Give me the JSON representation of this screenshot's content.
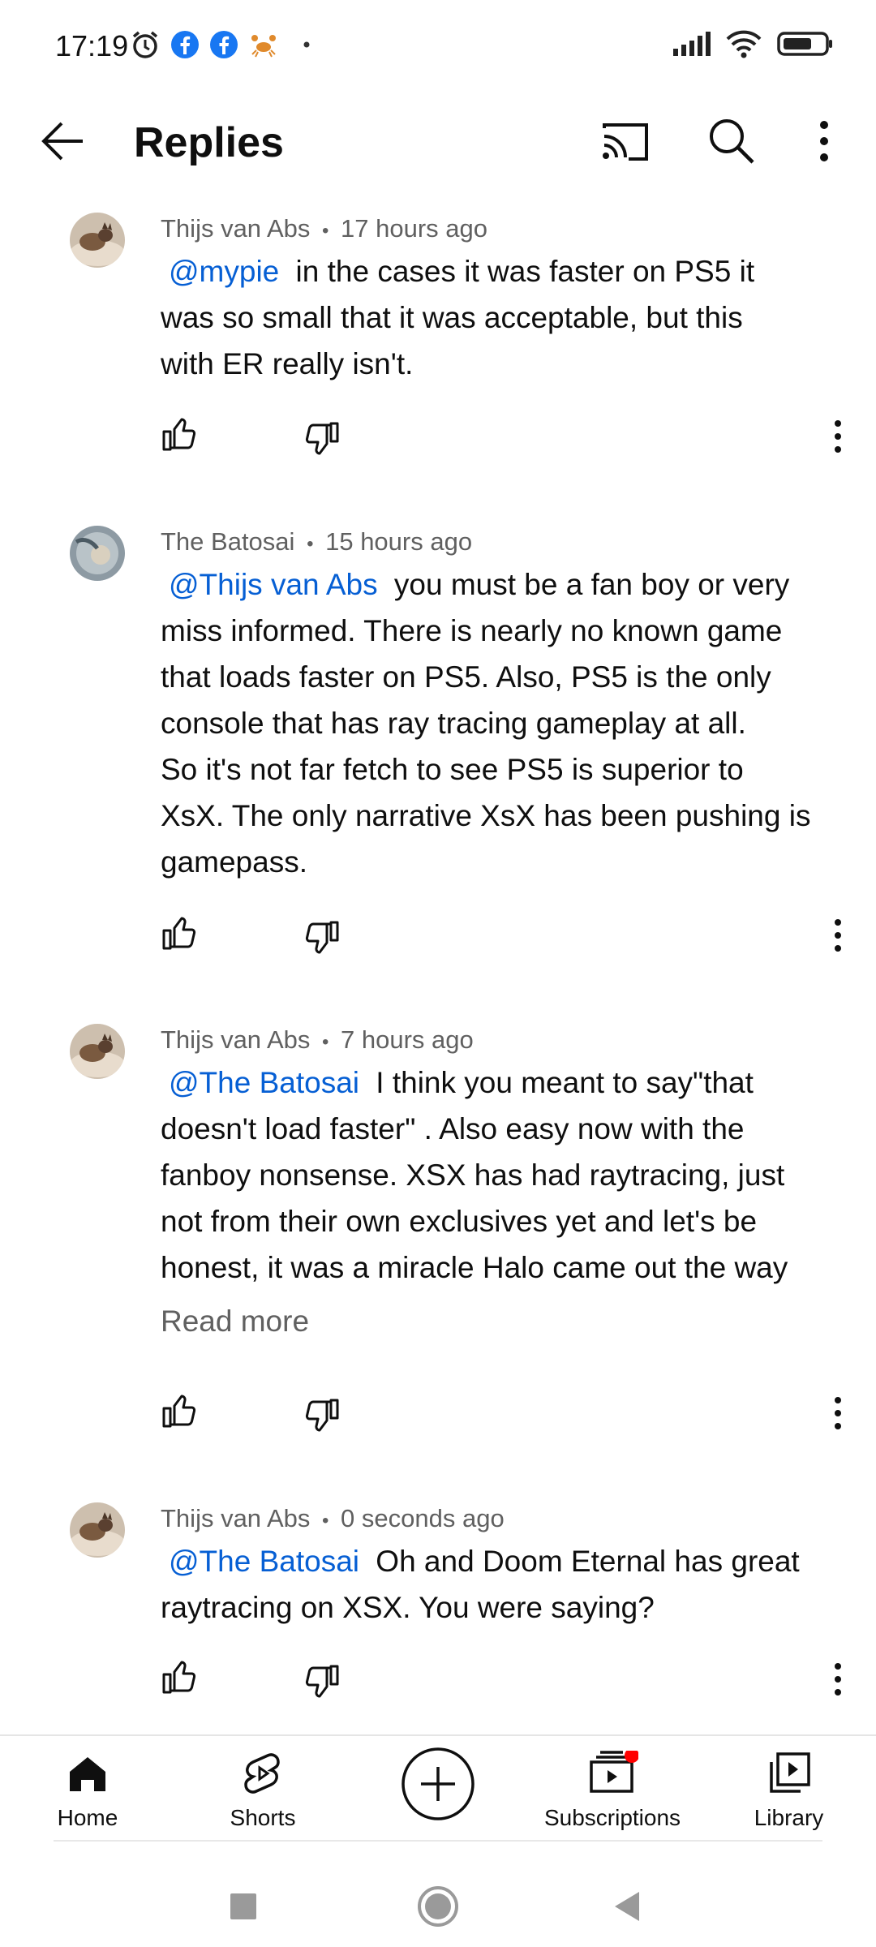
{
  "status_bar": {
    "time": "17:19",
    "left_icons": [
      "alarm-icon",
      "facebook-icon",
      "facebook-icon",
      "crab-icon",
      "dot-icon"
    ],
    "right_icons": [
      "signal-icon",
      "wifi-icon",
      "battery-icon"
    ]
  },
  "app_bar": {
    "title": "Replies",
    "icons": [
      "back-arrow-icon",
      "cast-icon",
      "search-icon",
      "more-vertical-icon"
    ]
  },
  "comments": [
    {
      "author": "Thijs van Abs",
      "separator": "•",
      "time": "17 hours ago",
      "mention": "@mypie",
      "lines": [
        " in the cases it was faster on PS5 it",
        "was so small that it was acceptable, but this",
        "with ER really isn't."
      ]
    },
    {
      "author": "The Batosai",
      "separator": "•",
      "time": "15 hours ago",
      "mention": "@Thijs van Abs",
      "lines": [
        " you must be a fan boy or very",
        "miss informed. There is nearly no known game",
        "that loads faster on PS5. Also, PS5 is the only",
        "console that has ray tracing gameplay at all.",
        "So it's not far fetch to see  PS5 is superior to",
        "XsX. The only narrative XsX has been pushing is",
        "gamepass."
      ]
    },
    {
      "author": "Thijs van Abs",
      "separator": "•",
      "time": "7 hours ago",
      "mention": "@The Batosai",
      "lines": [
        " I think you meant to say\"that",
        "doesn't load faster\" . Also easy now with the",
        "fanboy nonsense. XSX has had raytracing, just",
        "not from their own exclusives yet and let's be",
        "honest, it was a miracle Halo came out the way"
      ],
      "read_more": "Read more"
    },
    {
      "author": "Thijs van Abs",
      "separator": "•",
      "time": "0 seconds ago",
      "mention": "@The Batosai",
      "lines": [
        " Oh and Doom Eternal has great",
        "raytracing on XSX. You were saying?"
      ]
    }
  ],
  "bottom_nav": {
    "home": "Home",
    "shorts": "Shorts",
    "create": "create-plus-icon",
    "subscriptions": "Subscriptions",
    "library": "Library",
    "colors": {
      "notification_dot": "#ff0000",
      "mention": "#065fd4",
      "meta": "#606060"
    }
  },
  "system_nav": [
    "recents-square-icon",
    "home-circle-icon",
    "back-triangle-icon"
  ]
}
